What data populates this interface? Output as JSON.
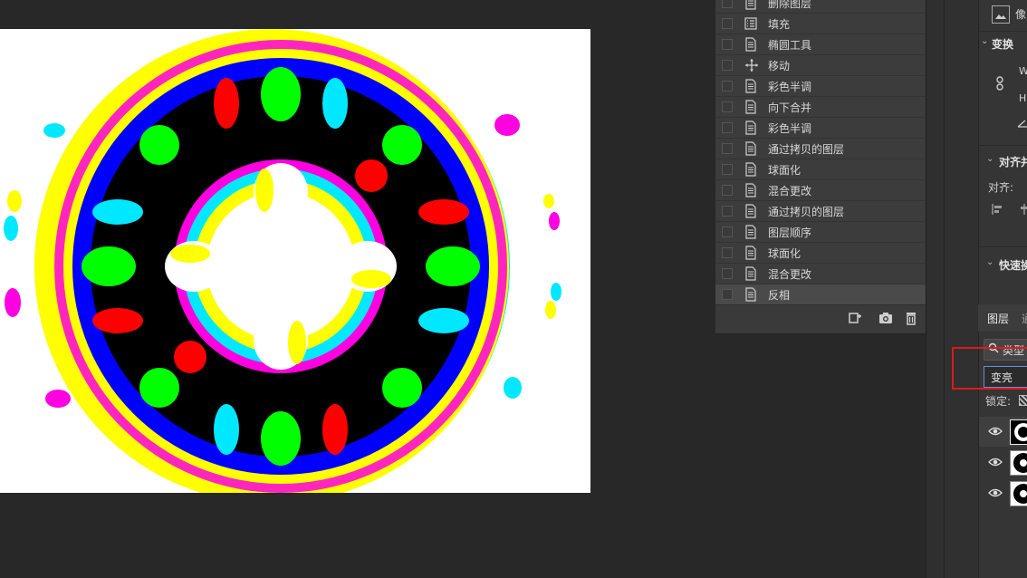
{
  "history": {
    "items": [
      {
        "label": "删除图层",
        "icon": "document-icon"
      },
      {
        "label": "填充",
        "icon": "list-icon"
      },
      {
        "label": "椭圆工具",
        "icon": "document-icon"
      },
      {
        "label": "移动",
        "icon": "move-icon"
      },
      {
        "label": "彩色半调",
        "icon": "document-icon"
      },
      {
        "label": "向下合并",
        "icon": "document-icon"
      },
      {
        "label": "彩色半调",
        "icon": "document-icon"
      },
      {
        "label": "通过拷贝的图层",
        "icon": "document-icon"
      },
      {
        "label": "球面化",
        "icon": "document-icon"
      },
      {
        "label": "混合更改",
        "icon": "document-icon"
      },
      {
        "label": "通过拷贝的图层",
        "icon": "document-icon"
      },
      {
        "label": "图层顺序",
        "icon": "document-icon"
      },
      {
        "label": "球面化",
        "icon": "document-icon"
      },
      {
        "label": "混合更改",
        "icon": "document-icon"
      },
      {
        "label": "反相",
        "icon": "document-icon",
        "selected": true
      }
    ],
    "footer_buttons": [
      "new-document-from-state-icon",
      "camera-icon",
      "trash-icon"
    ]
  },
  "properties": {
    "pixel_label": "像",
    "transform_title": "变换",
    "w_label": "W",
    "h_label": "H",
    "align_title": "对齐并",
    "align_label": "对齐:",
    "quick_title": "快速操"
  },
  "layers": {
    "tab_label": "图层",
    "tab2_label": "通",
    "kind_label": "类型",
    "blend_mode": "变亮",
    "lock_label": "锁定:"
  },
  "colors": {
    "highlight": "#e0191b",
    "panel": "#3a3a3a",
    "background": "#282828"
  }
}
